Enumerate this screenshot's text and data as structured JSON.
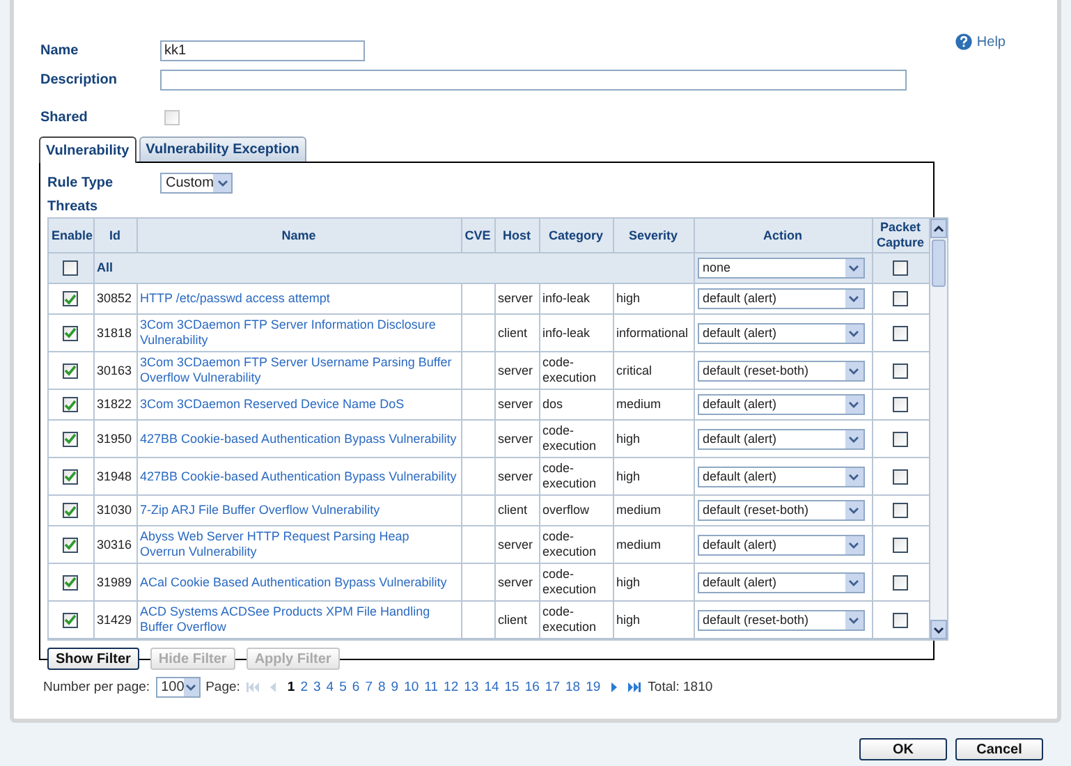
{
  "help": "Help",
  "form": {
    "name_label": "Name",
    "name_value": "kk1",
    "description_label": "Description",
    "shared_label": "Shared",
    "shared": false
  },
  "tabs": [
    {
      "label": "Vulnerability",
      "selected": true
    },
    {
      "label": "Vulnerability Exception",
      "selected": false
    }
  ],
  "rule_type": {
    "label": "Rule Type",
    "value": "Custom"
  },
  "threats_label": "Threats",
  "table": {
    "columns": [
      "Enable",
      "Id",
      "Name",
      "CVE",
      "Host",
      "Category",
      "Severity",
      "Action",
      "Packet Capture"
    ],
    "all_row": {
      "checked": false,
      "label": "All",
      "action": "none",
      "packet_capture": false
    },
    "rows": [
      {
        "enabled": true,
        "id": "30852",
        "name": "HTTP /etc/passwd access attempt",
        "host": "server",
        "category": "info-leak",
        "severity": "high",
        "action": "default (alert)",
        "packet_capture": false
      },
      {
        "enabled": true,
        "id": "31818",
        "name": "3Com 3CDaemon FTP Server Information Disclosure Vulnerability",
        "host": "client",
        "category": "info-leak",
        "severity": "informational",
        "action": "default (alert)",
        "packet_capture": false
      },
      {
        "enabled": true,
        "id": "30163",
        "name": "3Com 3CDaemon FTP Server Username Parsing Buffer Overflow Vulnerability",
        "host": "server",
        "category": "code-execution",
        "severity": "critical",
        "action": "default (reset-both)",
        "packet_capture": false
      },
      {
        "enabled": true,
        "id": "31822",
        "name": "3Com 3CDaemon Reserved Device Name DoS",
        "host": "server",
        "category": "dos",
        "severity": "medium",
        "action": "default (alert)",
        "packet_capture": false
      },
      {
        "enabled": true,
        "id": "31950",
        "name": "427BB Cookie-based Authentication Bypass Vulnerability",
        "host": "server",
        "category": "code-execution",
        "severity": "high",
        "action": "default (alert)",
        "packet_capture": false
      },
      {
        "enabled": true,
        "id": "31948",
        "name": "427BB Cookie-based Authentication Bypass Vulnerability",
        "host": "server",
        "category": "code-execution",
        "severity": "high",
        "action": "default (alert)",
        "packet_capture": false
      },
      {
        "enabled": true,
        "id": "31030",
        "name": "7-Zip ARJ File Buffer Overflow Vulnerability",
        "host": "client",
        "category": "overflow",
        "severity": "medium",
        "action": "default (reset-both)",
        "packet_capture": false
      },
      {
        "enabled": true,
        "id": "30316",
        "name": "Abyss Web Server HTTP Request Parsing Heap Overrun Vulnerability",
        "host": "server",
        "category": "code-execution",
        "severity": "medium",
        "action": "default (alert)",
        "packet_capture": false
      },
      {
        "enabled": true,
        "id": "31989",
        "name": "ACal Cookie Based Authentication Bypass Vulnerability",
        "host": "server",
        "category": "code-execution",
        "severity": "high",
        "action": "default (alert)",
        "packet_capture": false
      },
      {
        "enabled": true,
        "id": "31429",
        "name": "ACD Systems ACDSee Products XPM File Handling Buffer Overflow",
        "host": "client",
        "category": "code-execution",
        "severity": "high",
        "action": "default (reset-both)",
        "packet_capture": false
      }
    ]
  },
  "filter_buttons": [
    {
      "label": "Show Filter",
      "disabled": false
    },
    {
      "label": "Hide Filter",
      "disabled": true
    },
    {
      "label": "Apply Filter",
      "disabled": true
    }
  ],
  "pagination": {
    "per_page_label": "Number per page:",
    "per_page": "100",
    "page_label": "Page:",
    "nav": [
      {
        "kind": "first",
        "disabled": true
      },
      {
        "kind": "prev",
        "disabled": true
      },
      {
        "kind": "next",
        "disabled": false
      },
      {
        "kind": "last",
        "disabled": false
      }
    ],
    "pages": [
      {
        "label": "1",
        "selected": true
      },
      {
        "label": "2",
        "selected": false
      },
      {
        "label": "3",
        "selected": false
      },
      {
        "label": "4",
        "selected": false
      },
      {
        "label": "5",
        "selected": false
      },
      {
        "label": "6",
        "selected": false
      },
      {
        "label": "7",
        "selected": false
      },
      {
        "label": "8",
        "selected": false
      },
      {
        "label": "9",
        "selected": false
      },
      {
        "label": "10",
        "selected": false
      },
      {
        "label": "11",
        "selected": false
      },
      {
        "label": "12",
        "selected": false
      },
      {
        "label": "13",
        "selected": false
      },
      {
        "label": "14",
        "selected": false
      },
      {
        "label": "15",
        "selected": false
      },
      {
        "label": "16",
        "selected": false
      },
      {
        "label": "17",
        "selected": false
      },
      {
        "label": "18",
        "selected": false
      },
      {
        "label": "19",
        "selected": false
      }
    ],
    "total": "Total: 1810"
  },
  "buttons": [
    "OK",
    "Cancel"
  ]
}
